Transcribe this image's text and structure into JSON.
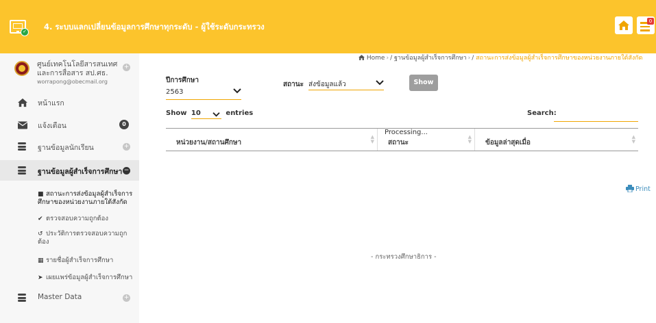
{
  "header": {
    "title": "4. ระบบแลกเปลี่ยนข้อมูลการศึกษาทุกระดับ - ผู้ใช้ระดับกระทรวง",
    "notification_count": "0",
    "colors": {
      "header_bg": "#fcc42c",
      "accent": "#f0a500"
    }
  },
  "sidebar": {
    "org_name": "ศูนย์เทคโนโลยีสารสนเทศและการสื่อสาร สป.ศธ.",
    "org_email": "worrapong@obecmail.org",
    "org_toggle": "+",
    "items": [
      {
        "label": "หน้าแรก",
        "icon": "home-icon"
      },
      {
        "label": "แจ้งเตือน",
        "icon": "envelope-icon",
        "badge": "0"
      },
      {
        "label": "ฐานข้อมูลนักเรียน",
        "icon": "database-icon",
        "toggle": "+"
      },
      {
        "label": "ฐานข้อมูลผู้สำเร็จการศึกษา",
        "icon": "database-icon",
        "toggle": "−"
      },
      {
        "label": "Master Data",
        "icon": "database-icon",
        "toggle": "+"
      }
    ],
    "subitems": [
      {
        "label": "สถานะการส่งข้อมูลผู้สำเร็จการศึกษาของหน่วยงานภายใต้สังกัด",
        "icon": "■"
      },
      {
        "label": "ตรวจสอบความถูกต้อง",
        "icon": "✔"
      },
      {
        "label": "ประวัติการตรวจสอบความถูกต้อง",
        "icon": "↺"
      },
      {
        "label": "รายชื่อผู้สำเร็จการศึกษา",
        "icon": "▦"
      },
      {
        "label": "เผยแพร่ข้อมูลผู้สำเร็จการศึกษา",
        "icon": "➤"
      }
    ]
  },
  "breadcrumb": {
    "home": "Home",
    "level1": "ฐานข้อมูลผู้สำเร็จการศึกษา",
    "current": "สถานะการส่งข้อมูลผู้สำเร็จการศึกษาของหน่วยงานภายใต้สังกัด"
  },
  "filters": {
    "year_label": "ปีการศึกษา",
    "year_value": "2563",
    "status_label": "สถานะ",
    "status_value": "ส่งข้อมูลแล้ว",
    "show_button": "Show"
  },
  "table_controls": {
    "show_label": "Show",
    "entries_value": "10",
    "entries_label": "entries",
    "search_label": "Search:",
    "search_value": ""
  },
  "table": {
    "columns": [
      "หน่วยงาน/สถานศึกษา",
      "สถานะ",
      "ข้อมูลล่าสุดเมื่อ"
    ],
    "processing": "Processing..."
  },
  "print_label": "Print",
  "footer": "- กระทรวงศึกษาธิการ -"
}
